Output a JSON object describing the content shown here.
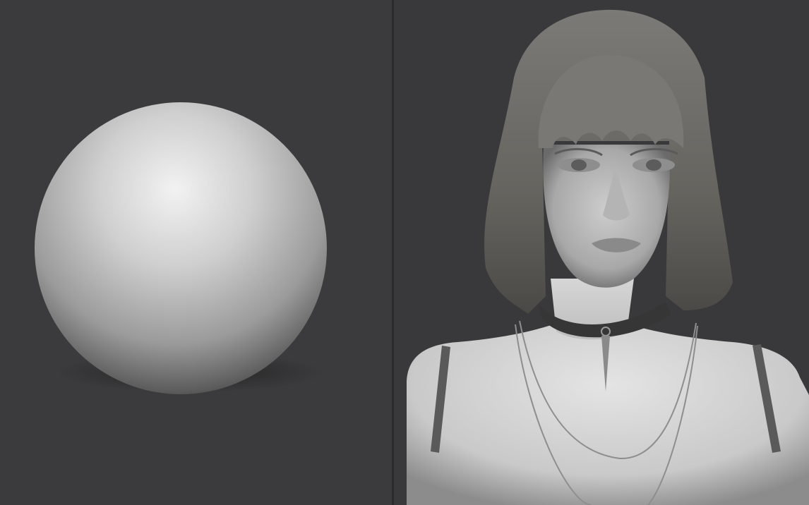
{
  "scene": {
    "panels": [
      {
        "id": "left",
        "subject": "sphere"
      },
      {
        "id": "right",
        "subject": "bust"
      }
    ]
  },
  "colors": {
    "background": "#3a393b",
    "divider": "#2b2a2c",
    "clay_light": "#e6e6e6",
    "clay_mid": "#9a9a9a",
    "clay_dark": "#2e2e2e",
    "hair": "#6e6c69",
    "choker": "#3a3a3a"
  }
}
